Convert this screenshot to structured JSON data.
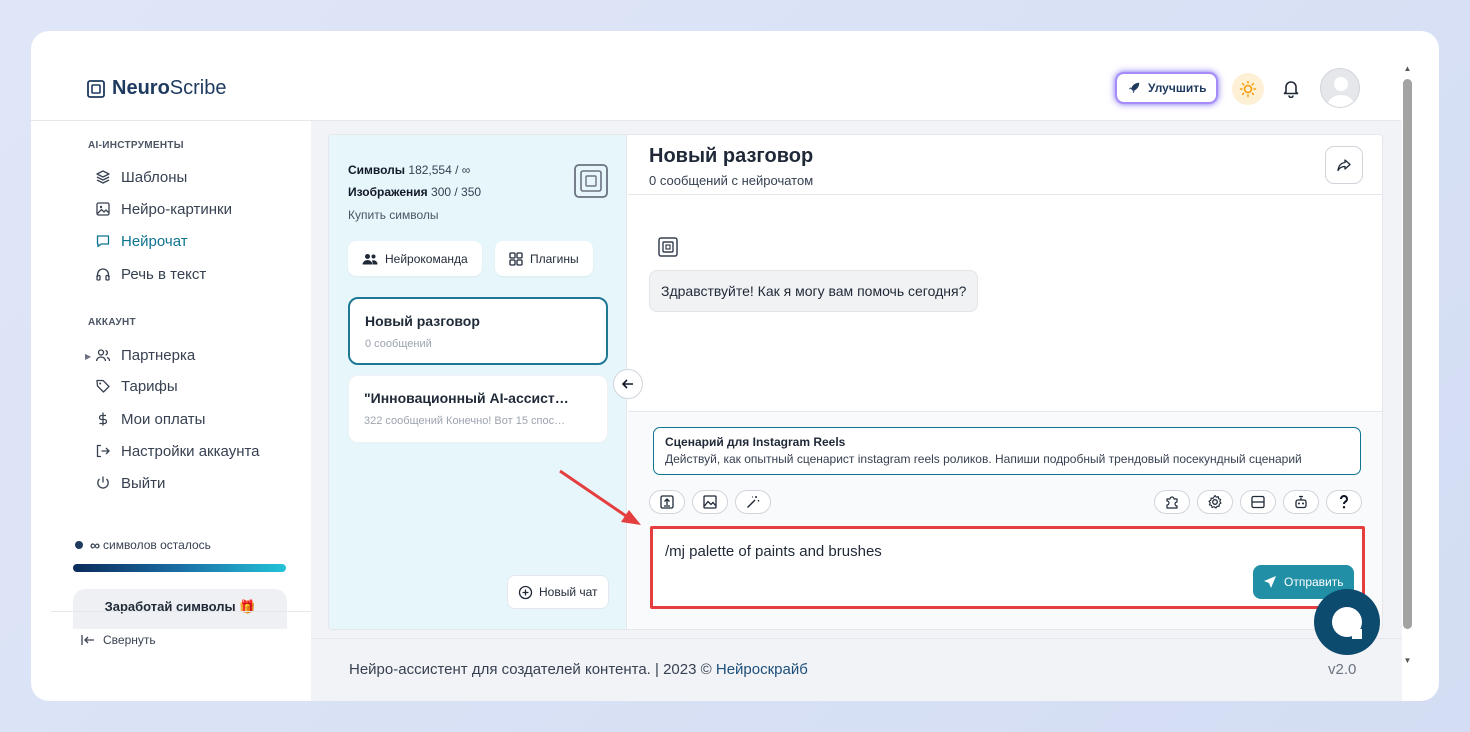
{
  "brand": {
    "bold": "Neuro",
    "rest": "Scribe"
  },
  "header": {
    "upgrade_label": "Улучшить"
  },
  "sidebar": {
    "section_tools": "AI-ИНСТРУМЕНТЫ",
    "tools": [
      {
        "label": "Шаблоны",
        "icon": "layers-icon"
      },
      {
        "label": "Нейро-картинки",
        "icon": "image-icon"
      },
      {
        "label": "Нейрочат",
        "icon": "chat-icon",
        "active": true
      },
      {
        "label": "Речь в текст",
        "icon": "headphones-icon"
      }
    ],
    "section_account": "АККАУНТ",
    "account": [
      {
        "label": "Партнерка",
        "icon": "users-icon"
      },
      {
        "label": "Тарифы",
        "icon": "tag-icon"
      },
      {
        "label": "Мои оплаты",
        "icon": "dollar-icon"
      },
      {
        "label": "Настройки аккаунта",
        "icon": "login-icon"
      },
      {
        "label": "Выйти",
        "icon": "power-icon"
      }
    ],
    "symbols_left_value": "∞",
    "symbols_left_label": "символов осталось",
    "earn_label": "Заработай символы 🎁",
    "collapse_label": "Свернуть"
  },
  "stats": {
    "symbols_label": "Символы",
    "symbols_value": "182,554 / ∞",
    "images_label": "Изображения",
    "images_value": "300 / 350",
    "buy_label": "Купить символы"
  },
  "buttons": {
    "team": "Нейрокоманда",
    "plugins": "Плагины",
    "new_chat": "Новый чат",
    "send": "Отправить"
  },
  "chats": [
    {
      "title": "Новый разговор",
      "subtitle": "0 сообщений"
    },
    {
      "title": "\"Инновационный AI-ассист…",
      "subtitle": "322 сообщений Конечно! Вот 15 спос…"
    }
  ],
  "conversation": {
    "title": "Новый разговор",
    "subtitle": "0 сообщений с нейрочатом",
    "greeting": "Здравствуйте! Как я могу вам помочь сегодня?"
  },
  "template": {
    "title": "Сценарий для Instagram Reels",
    "description": "Действуй, как опытный сценарист instagram reels роликов. Напиши подробный трендовый посекундный сценарий"
  },
  "composer": {
    "value": "/mj palette of paints and brushes"
  },
  "footer": {
    "text": "Нейро-ассистент для создателей контента.  | 2023 ©",
    "link": "Нейроскрайб",
    "version": "v2.0"
  },
  "colors": {
    "accent": "#0e7490",
    "send": "#2190a6",
    "highlight": "#e53e3e",
    "brand": "#1e3a5f"
  }
}
